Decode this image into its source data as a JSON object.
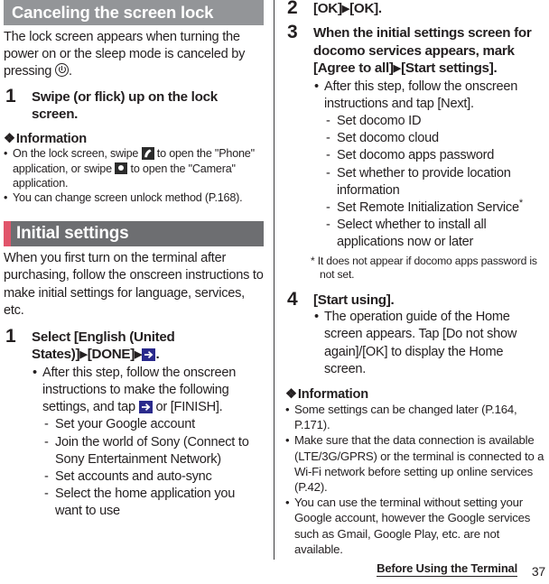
{
  "document": {
    "footer_title": "Before Using the Terminal",
    "page_number": "37"
  },
  "colors": {
    "header_gray": "#939598",
    "header_dark_gray": "#6d6e71",
    "accent_red": "#e1556b",
    "arrow_blue": "#2a2a8c",
    "icon_dark": "#2b2b2b",
    "text": "#231f20"
  },
  "left_column": {
    "section1": {
      "heading": "Canceling the screen lock",
      "intro_part1": "The lock screen appears when turning the power on or the sleep mode is canceled by pressing ",
      "intro_part2": ".",
      "power_icon": "power-button-icon",
      "step1": {
        "number": "1",
        "title": "Swipe (or flick) up on the lock screen."
      },
      "information": {
        "heading": "Information",
        "diamond": "❖",
        "items": [
          {
            "segments": [
              "On the lock screen, swipe ",
              " to open the \"Phone\" application, or swipe ",
              " to open the \"Camera\" application."
            ],
            "icons": [
              "phone-icon",
              "camera-icon"
            ]
          },
          {
            "text": "You can change screen unlock method (P.168)."
          }
        ]
      }
    },
    "section2": {
      "heading": "Initial settings",
      "intro": "When you first turn on the terminal after purchasing, follow the onscreen instructions to make initial settings for language, services, etc.",
      "step1": {
        "number": "1",
        "title_part1": "Select [English (United States)]",
        "title_arrow1": "▶",
        "title_part2": "[DONE]",
        "title_arrow2": "▶",
        "title_icon": "blue-arrow-icon",
        "title_part3": ".",
        "bullet_part1": "After this step, follow the onscreen instructions to make the following settings, and tap ",
        "bullet_icon": "blue-arrow-icon",
        "bullet_part2": " or [FINISH].",
        "dash_items": [
          "Set your Google account",
          "Join the world of Sony (Connect to Sony Entertainment Network)",
          "Set accounts and auto-sync",
          "Select the home application you want to use"
        ]
      }
    }
  },
  "right_column": {
    "step2": {
      "number": "2",
      "title_part1": "[OK]",
      "title_arrow": "▶",
      "title_part2": "[OK]."
    },
    "step3": {
      "number": "3",
      "title_part1": "When the initial settings screen for docomo services appears, mark [Agree to all]",
      "title_arrow": "▶",
      "title_part2": "[Start settings].",
      "bullet": "After this step, follow the onscreen instructions and tap [Next].",
      "dash_items": [
        "Set docomo ID",
        "Set docomo cloud",
        "Set docomo apps password",
        "Set whether to provide location information",
        "Set Remote Initialization Service",
        "Select whether to install all applications now or later"
      ],
      "footnote_marker": "*",
      "footnote": "It does not appear if docomo apps password is not set."
    },
    "step4": {
      "number": "4",
      "title": "[Start using].",
      "bullet": "The operation guide of the Home screen appears. Tap [Do not show again]/[OK] to display the Home screen."
    },
    "information": {
      "heading": "Information",
      "diamond": "❖",
      "items": [
        "Some settings can be changed later (P.164, P.171).",
        "Make sure that the data connection is available (LTE/3G/GPRS) or the terminal is connected to a Wi-Fi network before setting up online services (P.42).",
        "You can use the terminal without setting your Google account, however the Google services such as Gmail, Google Play, etc. are not available."
      ]
    }
  }
}
